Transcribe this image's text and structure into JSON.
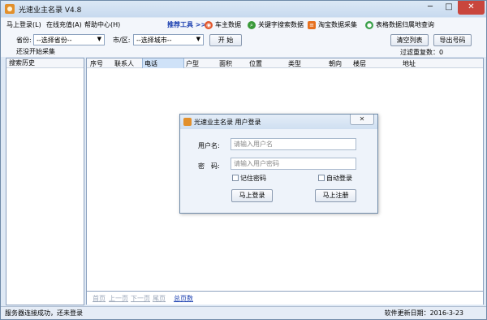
{
  "window": {
    "title": "光速业主名录 V4.8",
    "minimize": "─",
    "maximize": "□",
    "close": "✕"
  },
  "menu": {
    "items": [
      {
        "label": "马上登录(L)"
      },
      {
        "label": "在线充值(A)"
      },
      {
        "label": "帮助中心(H)"
      }
    ],
    "recommend_label": "推荐工具 >>",
    "tools": [
      {
        "label": "车主数据",
        "icon": "car-owner-icon",
        "color": "#e2572c"
      },
      {
        "label": "关键字搜索数据",
        "icon": "keyword-search-icon",
        "color": "#3a9a3a"
      },
      {
        "label": "淘宝数据采集",
        "icon": "taobao-icon",
        "color": "#e7701e"
      },
      {
        "label": "表格数据归属地查询",
        "icon": "location-query-icon",
        "color": "#3aa04a"
      }
    ]
  },
  "filters": {
    "province_label": "省份:",
    "province_value": "--选择省份--",
    "city_label": "市/区:",
    "city_value": "--选择城市--",
    "start_button": "开 始",
    "status_text": "还没开始采集",
    "clear_button": "清空列表",
    "export_button": "导出号码",
    "dedupe_text": "过滤重复数：0"
  },
  "history": {
    "header": "搜索历史"
  },
  "table": {
    "columns": [
      "序号",
      "联系人",
      "电话",
      "户型",
      "面积",
      "位置",
      "类型",
      "朝向",
      "楼层",
      "地址"
    ]
  },
  "pager": {
    "first": "首页",
    "prev": "上一页",
    "next": "下一页",
    "last": "尾页",
    "total": "总页数"
  },
  "status": {
    "left": "服务器连接成功，还未登录",
    "right": "软件更新日期：2016-3-23"
  },
  "login_dialog": {
    "title": "光速业主名录 用户登录",
    "close": "✕",
    "username_label": "用户名:",
    "username_placeholder": "请输入用户名",
    "password_label": "密　码:",
    "password_placeholder": "请输入用户密码",
    "remember_label": "记住密码",
    "autologin_label": "自动登录",
    "login_button": "马上登录",
    "register_button": "马上注册"
  }
}
